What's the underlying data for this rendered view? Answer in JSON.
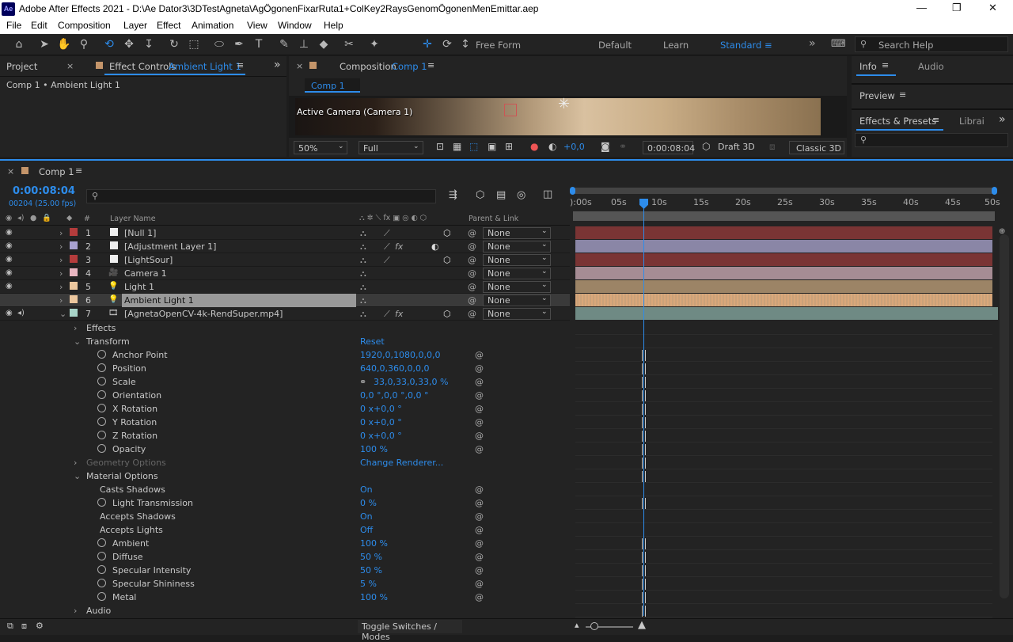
{
  "window": {
    "title": "Adobe After Effects 2021 - D:\\Ae Dator3\\3DTestAgneta\\AgÖgonenFixarRuta1+ColKey2RaysGenomÖgonenMenEmittar.aep",
    "logo": "Ae"
  },
  "menu": [
    "File",
    "Edit",
    "Composition",
    "Layer",
    "Effect",
    "Animation",
    "View",
    "Window",
    "Help"
  ],
  "toolbar": {
    "free_form": "Free Form",
    "workspaces": [
      "Default",
      "Learn",
      "Standard"
    ],
    "search_placeholder": "Search Help"
  },
  "panels": {
    "project_tab": "Project",
    "effect_controls_label": "Effect Controls",
    "effect_controls_layer": "Ambient Light 1",
    "effect_breadcrumb": "Comp 1 • Ambient Light 1",
    "composition_label": "Composition",
    "composition_name": "Comp 1",
    "comp_tab": "Comp 1",
    "active_camera": "Active Camera (Camera 1)",
    "zoom": "50%",
    "quality": "Full",
    "exposure": "+0,0",
    "timecode_viewer": "0:00:08:04",
    "draft3d": "Draft 3D",
    "renderer": "Classic 3D",
    "info": "Info",
    "audio": "Audio",
    "preview": "Preview",
    "effects_presets": "Effects & Presets",
    "libraries": "Librai"
  },
  "timeline": {
    "tab": "Comp 1",
    "timecode": "0:00:08:04",
    "frames": "00204 (25.00 fps)",
    "col_layer_name": "Layer Name",
    "col_parent": "Parent & Link",
    "col_num": "#",
    "ruler": [
      "):00s",
      "05s",
      "10s",
      "15s",
      "20s",
      "25s",
      "30s",
      "35s",
      "40s",
      "45s",
      "50s"
    ],
    "layers": [
      {
        "num": "1",
        "name": "[Null 1]",
        "color": "#b43c3c",
        "parent": "None"
      },
      {
        "num": "2",
        "name": "[Adjustment Layer 1]",
        "color": "#a9a2d0",
        "parent": "None"
      },
      {
        "num": "3",
        "name": "[LightSour]",
        "color": "#b43c3c",
        "parent": "None"
      },
      {
        "num": "4",
        "name": "Camera 1",
        "color": "#e8b5c0",
        "parent": "None"
      },
      {
        "num": "5",
        "name": "Light 1",
        "color": "#ecc79e",
        "parent": "None"
      },
      {
        "num": "6",
        "name": "Ambient Light 1",
        "color": "#ecc79e",
        "parent": "None"
      },
      {
        "num": "7",
        "name": "[AgnetaOpenCV-4k-RendSuper.mp4]",
        "color": "#a8d4c8",
        "parent": "None"
      }
    ],
    "props": [
      {
        "name": "Effects",
        "value": "",
        "indent": 1,
        "arrow": "›",
        "stop": false
      },
      {
        "name": "Transform",
        "value": "Reset",
        "indent": 1,
        "arrow": "⌄",
        "stop": false
      },
      {
        "name": "Anchor Point",
        "value": "1920,0,1080,0,0,0",
        "indent": 2,
        "stop": true
      },
      {
        "name": "Position",
        "value": "640,0,360,0,0,0",
        "indent": 2,
        "stop": true
      },
      {
        "name": "Scale",
        "value": "33,0,33,0,33,0 %",
        "indent": 2,
        "stop": true
      },
      {
        "name": "Orientation",
        "value": "0,0 °,0,0 °,0,0 °",
        "indent": 2,
        "stop": true
      },
      {
        "name": "X Rotation",
        "value": "0 x+0,0 °",
        "indent": 2,
        "stop": true
      },
      {
        "name": "Y Rotation",
        "value": "0 x+0,0 °",
        "indent": 2,
        "stop": true
      },
      {
        "name": "Z Rotation",
        "value": "0 x+0,0 °",
        "indent": 2,
        "stop": true
      },
      {
        "name": "Opacity",
        "value": "100 %",
        "indent": 2,
        "stop": true
      },
      {
        "name": "Geometry Options",
        "value": "Change Renderer...",
        "indent": 1,
        "arrow": "›",
        "stop": false,
        "dim": true
      },
      {
        "name": "Material Options",
        "value": "",
        "indent": 1,
        "arrow": "⌄",
        "stop": false
      },
      {
        "name": "Casts Shadows",
        "value": "On",
        "indent": 2,
        "stop": false
      },
      {
        "name": "Light Transmission",
        "value": "0 %",
        "indent": 2,
        "stop": true
      },
      {
        "name": "Accepts Shadows",
        "value": "On",
        "indent": 2,
        "stop": false
      },
      {
        "name": "Accepts Lights",
        "value": "Off",
        "indent": 2,
        "stop": false
      },
      {
        "name": "Ambient",
        "value": "100 %",
        "indent": 2,
        "stop": true
      },
      {
        "name": "Diffuse",
        "value": "50 %",
        "indent": 2,
        "stop": true
      },
      {
        "name": "Specular Intensity",
        "value": "50 %",
        "indent": 2,
        "stop": true
      },
      {
        "name": "Specular Shininess",
        "value": "5 %",
        "indent": 2,
        "stop": true
      },
      {
        "name": "Metal",
        "value": "100 %",
        "indent": 2,
        "stop": true
      },
      {
        "name": "Audio",
        "value": "",
        "indent": 1,
        "arrow": "›",
        "stop": false
      }
    ],
    "toggle": "Toggle Switches / Modes"
  }
}
